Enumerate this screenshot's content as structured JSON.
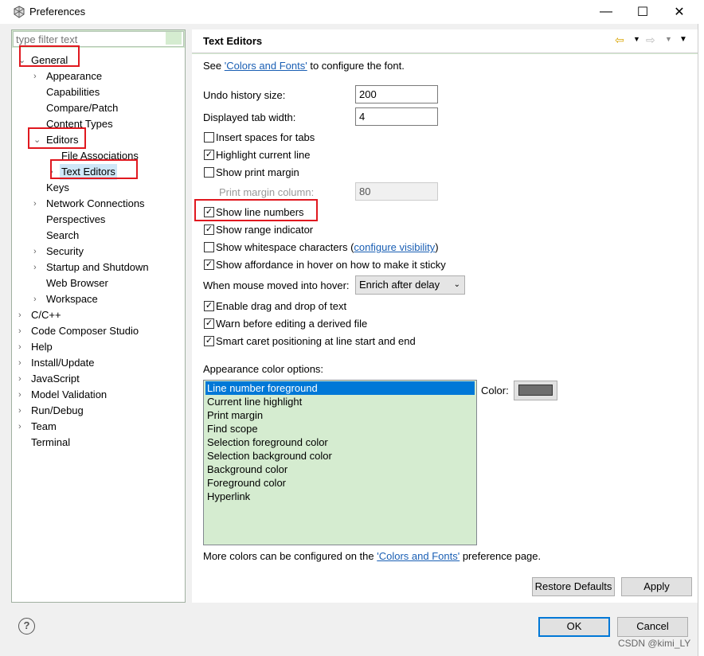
{
  "window": {
    "title": "Preferences",
    "controls": {
      "minimize": "—",
      "maximize": "☐",
      "close": "✕"
    }
  },
  "filter": {
    "placeholder": "type filter text"
  },
  "tree": {
    "general": "General",
    "appearance": "Appearance",
    "capabilities": "Capabilities",
    "compare_patch": "Compare/Patch",
    "content_types": "Content Types",
    "editors": "Editors",
    "file_associations": "File Associations",
    "text_editors": "Text Editors",
    "keys": "Keys",
    "network_connections": "Network Connections",
    "perspectives": "Perspectives",
    "search": "Search",
    "security": "Security",
    "startup_shutdown": "Startup and Shutdown",
    "web_browser": "Web Browser",
    "workspace": "Workspace",
    "cpp": "C/C++",
    "ccs": "Code Composer Studio",
    "help": "Help",
    "install_update": "Install/Update",
    "javascript": "JavaScript",
    "model_validation": "Model Validation",
    "run_debug": "Run/Debug",
    "team": "Team",
    "terminal": "Terminal"
  },
  "page": {
    "title": "Text Editors",
    "see_prefix": "See ",
    "see_link": "'Colors and Fonts'",
    "see_suffix": " to configure the font.",
    "undo_label": "Undo history size:",
    "undo_value": "200",
    "tab_label": "Displayed tab width:",
    "tab_value": "4",
    "insert_spaces": "Insert spaces for tabs",
    "highlight_line": "Highlight current line",
    "show_print_margin": "Show print margin",
    "print_margin_label": "Print margin column:",
    "print_margin_value": "80",
    "show_line_numbers": "Show line numbers",
    "show_range": "Show range indicator",
    "show_whitespace_prefix": "Show whitespace characters (",
    "show_whitespace_link": "configure visibility",
    "show_whitespace_suffix": ")",
    "show_affordance": "Show affordance in hover on how to make it sticky",
    "hover_label": "When mouse moved into hover:",
    "hover_value": "Enrich after delay",
    "drag_drop": "Enable drag and drop of text",
    "warn_derived": "Warn before editing a derived file",
    "smart_caret": "Smart caret positioning at line start and end",
    "appearance_label": "Appearance color options:",
    "color_label": "Color:",
    "color_swatch": "#6e6e6e",
    "more_prefix": "More colors can be configured on the ",
    "more_link": "'Colors and Fonts'",
    "more_suffix": " preference page.",
    "restore_defaults": "Restore Defaults",
    "apply": "Apply"
  },
  "color_options": [
    "Line number foreground",
    "Current line highlight",
    "Print margin",
    "Find scope",
    "Selection foreground color",
    "Selection background color",
    "Background color",
    "Foreground color",
    "Hyperlink"
  ],
  "dialog": {
    "ok": "OK",
    "cancel": "Cancel",
    "help": "?"
  },
  "watermark": "CSDN @kimi_LY"
}
